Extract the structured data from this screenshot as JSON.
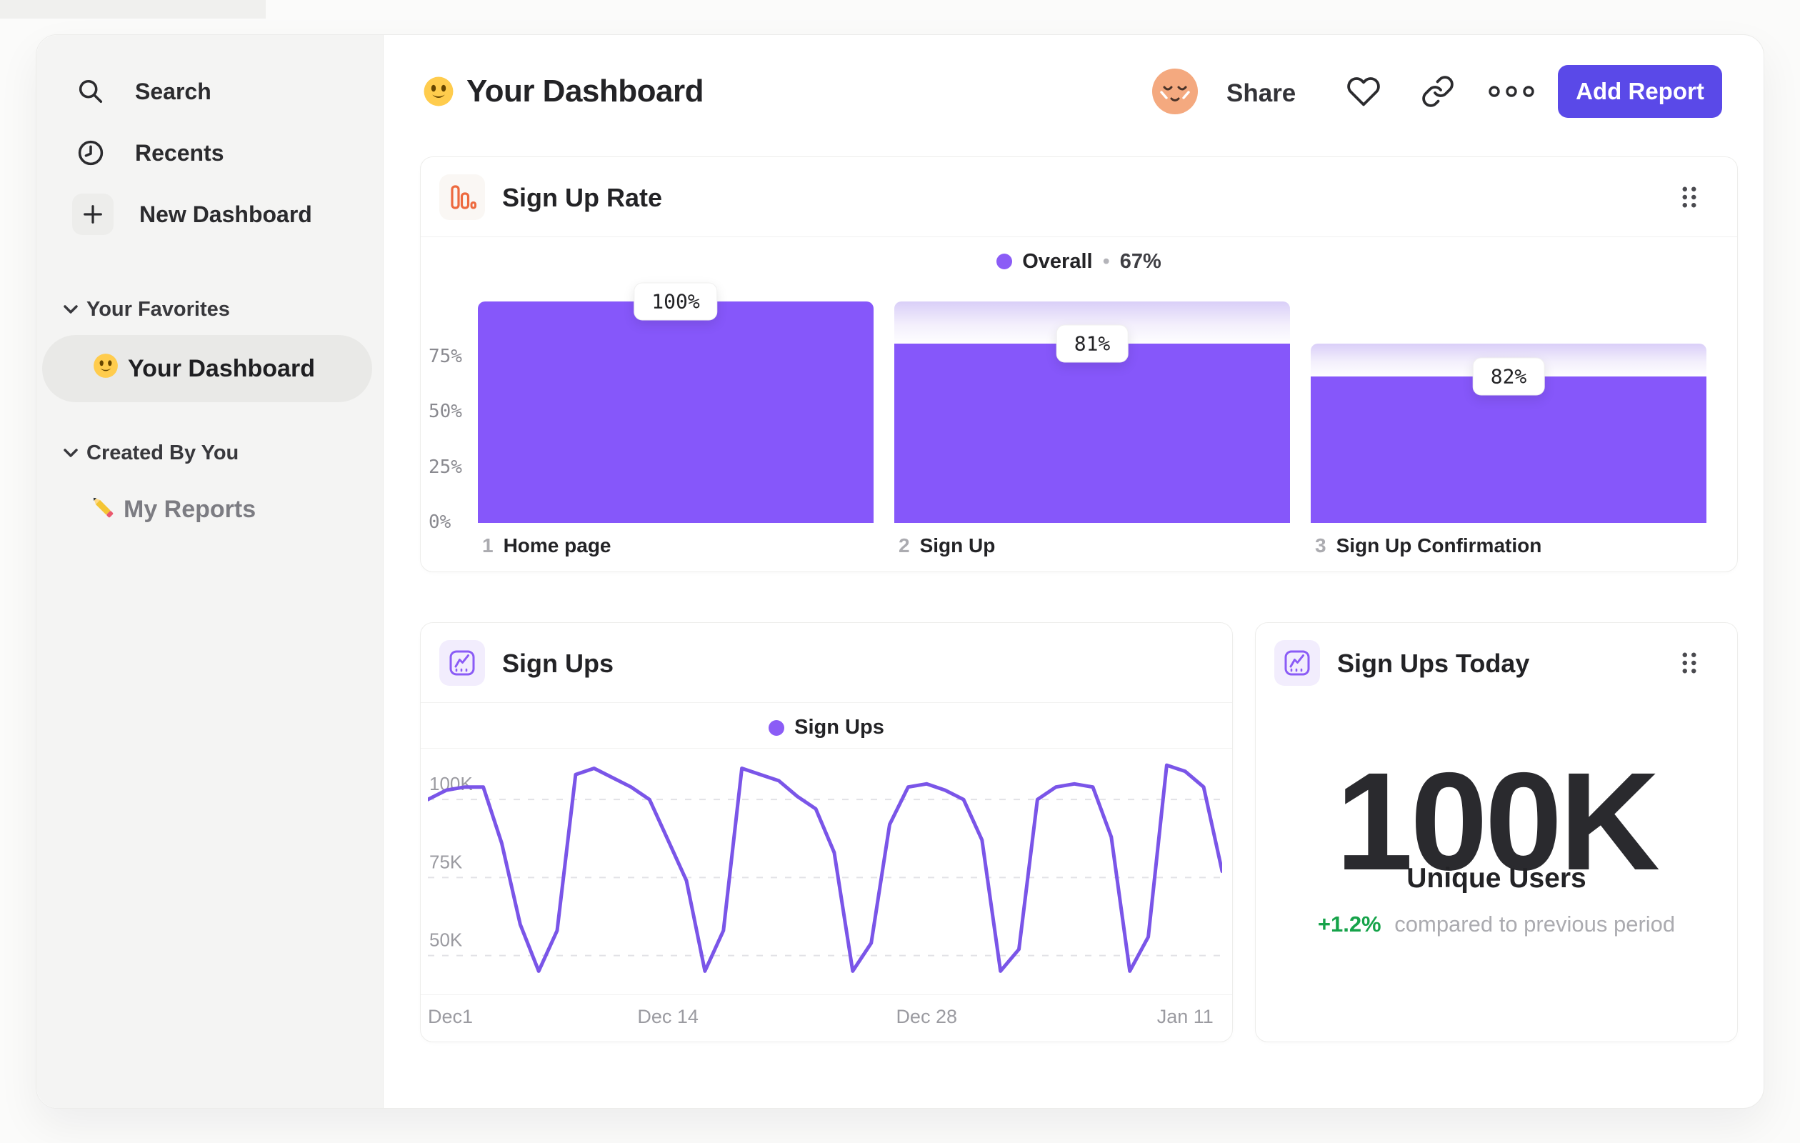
{
  "sidebar": {
    "nav": [
      {
        "label": "Search",
        "icon": "search-icon"
      },
      {
        "label": "Recents",
        "icon": "clock-icon"
      },
      {
        "label": "New Dashboard",
        "icon": "plus-icon"
      }
    ],
    "sections": [
      {
        "title": "Your Favorites",
        "items": [
          {
            "label": "Your Dashboard",
            "icon": "smiley-emoji",
            "selected": true
          }
        ]
      },
      {
        "title": "Created By You",
        "items": [
          {
            "label": "My Reports",
            "icon": "pencil-emoji",
            "selected": false
          }
        ]
      }
    ]
  },
  "header": {
    "title": "Your Dashboard",
    "share_label": "Share",
    "add_report_label": "Add Report",
    "accent_color": "#5A49E8"
  },
  "cards": {
    "signup_rate": {
      "title": "Sign Up Rate"
    },
    "signups": {
      "title": "Sign Ups"
    },
    "signups_today": {
      "title": "Sign Ups Today",
      "value": "100K",
      "value_label": "Unique Users",
      "delta": "+1.2%",
      "delta_note": "compared to previous period",
      "delta_color": "#16A34A"
    }
  },
  "chart_data": [
    {
      "id": "signup-rate-funnel",
      "type": "bar",
      "title": "Sign Up Rate",
      "legend": {
        "label": "Overall",
        "separator": "•",
        "value": "67%",
        "dot_color": "#8B5CF6",
        "position": "top-center"
      },
      "ylim": [
        0,
        100
      ],
      "y_ticks": [
        {
          "label": "75%",
          "value": 75
        },
        {
          "label": "50%",
          "value": 50
        },
        {
          "label": "25%",
          "value": 25
        },
        {
          "label": "0%",
          "value": 0
        }
      ],
      "grid": false,
      "bar_color": "#8657FA",
      "gradient_top_color": "#D9CEF8",
      "steps": [
        {
          "num": "1",
          "label": "Home page",
          "bar_total_pct": 100,
          "converted_pct_of_total": 100,
          "conversion_label": "100%"
        },
        {
          "num": "2",
          "label": "Sign Up",
          "bar_total_pct": 100,
          "converted_pct_of_total": 81,
          "conversion_label": "81%"
        },
        {
          "num": "3",
          "label": "Sign Up Confirmation",
          "bar_total_pct": 81,
          "converted_pct_of_total": 66,
          "conversion_label": "82%"
        }
      ]
    },
    {
      "id": "signups-line",
      "type": "line",
      "title": "Sign Ups",
      "legend": {
        "label": "Sign Ups",
        "dot_color": "#8B5CF6",
        "position": "top-center"
      },
      "line_color": "#7A55E8",
      "grid": "horizontal-dashed",
      "ylim": [
        38,
        114
      ],
      "values_unit": "thousands",
      "y_ticks": [
        {
          "label": "100K",
          "value": 100
        },
        {
          "label": "75K",
          "value": 75
        },
        {
          "label": "50K",
          "value": 50
        }
      ],
      "x_ticks": [
        {
          "label": "Dec1",
          "index": 0
        },
        {
          "label": "Dec 14",
          "index": 13
        },
        {
          "label": "Dec 28",
          "index": 27
        },
        {
          "label": "Jan 11",
          "index": 41
        }
      ],
      "values": [
        100,
        103,
        104,
        104,
        86,
        60,
        45,
        58,
        108,
        110,
        107,
        104,
        100,
        87,
        74,
        45,
        58,
        110,
        108,
        106,
        101,
        97,
        83,
        45,
        54,
        92,
        104,
        105,
        103,
        100,
        87,
        45,
        52,
        100,
        104,
        105,
        104,
        88,
        45,
        56,
        111,
        109,
        104,
        77
      ]
    }
  ]
}
